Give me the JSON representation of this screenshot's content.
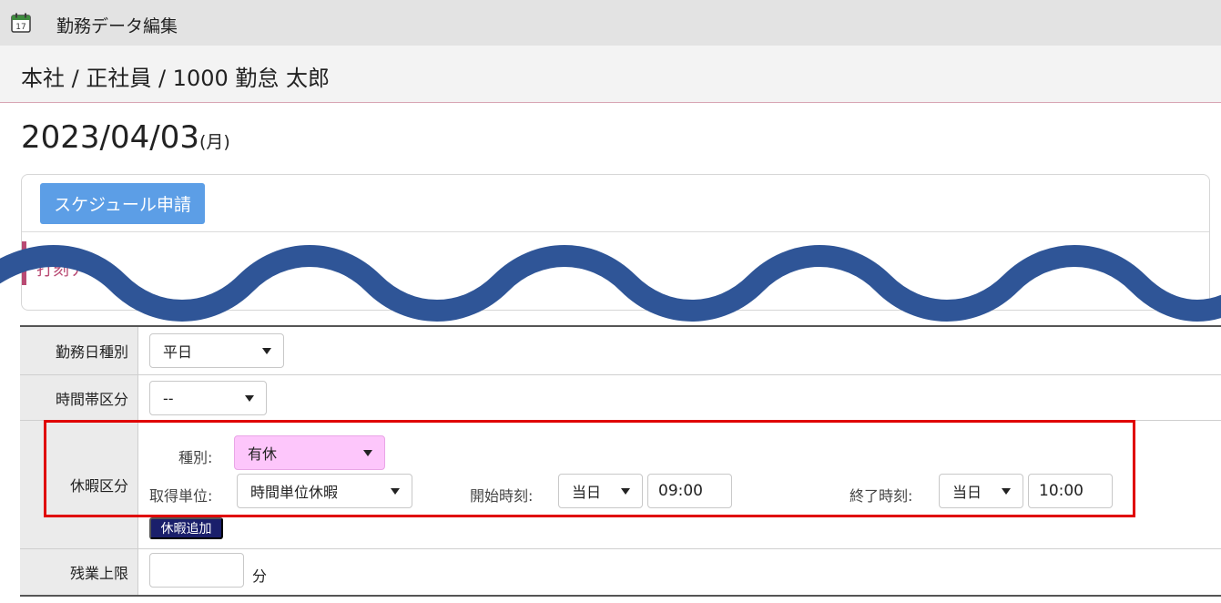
{
  "window": {
    "title": "勤務データ編集",
    "icon": "calendar-icon",
    "icon_day": "17"
  },
  "breadcrumb": "本社 / 正社員 / 1000 勤怠 太郎",
  "date": {
    "value": "2023/04/03",
    "day_of_week": "(月)"
  },
  "schedule_button": "スケジュール申請",
  "punch_section_title": "打刻デー",
  "form": {
    "workday_type": {
      "label": "勤務日種別",
      "value": "平日"
    },
    "time_zone": {
      "label": "時間帯区分",
      "value": "--"
    },
    "leave": {
      "label": "休暇区分",
      "type_label": "種別:",
      "type_value": "有休",
      "unit_label": "取得単位:",
      "unit_value": "時間単位休暇",
      "start_label": "開始時刻:",
      "start_day": "当日",
      "start_time": "09:00",
      "end_label": "終了時刻:",
      "end_day": "当日",
      "end_time": "10:00",
      "add_button": "休暇追加"
    },
    "overtime_limit": {
      "label": "残業上限",
      "value": "",
      "unit": "分"
    }
  },
  "colors": {
    "accent": "#5c9ee6",
    "section": "#b94a73",
    "highlight": "#e00000",
    "wave": "#2f5597",
    "leave_type_bg": "#fdc6fb",
    "add_button": "#1a1f6b"
  }
}
